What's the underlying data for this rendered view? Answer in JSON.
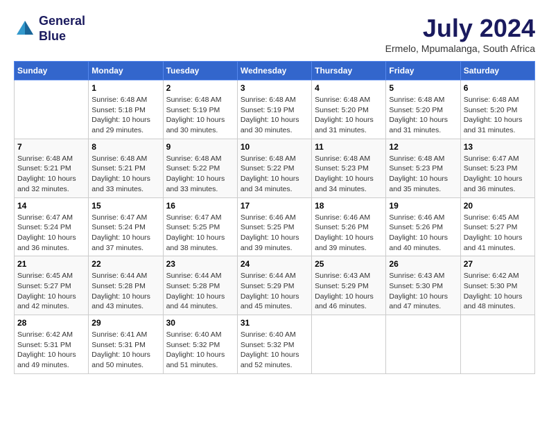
{
  "logo": {
    "line1": "General",
    "line2": "Blue"
  },
  "title": "July 2024",
  "location": "Ermelo, Mpumalanga, South Africa",
  "days_of_week": [
    "Sunday",
    "Monday",
    "Tuesday",
    "Wednesday",
    "Thursday",
    "Friday",
    "Saturday"
  ],
  "weeks": [
    [
      {
        "day": "",
        "sunrise": "",
        "sunset": "",
        "daylight": ""
      },
      {
        "day": "1",
        "sunrise": "Sunrise: 6:48 AM",
        "sunset": "Sunset: 5:18 PM",
        "daylight": "Daylight: 10 hours and 29 minutes."
      },
      {
        "day": "2",
        "sunrise": "Sunrise: 6:48 AM",
        "sunset": "Sunset: 5:19 PM",
        "daylight": "Daylight: 10 hours and 30 minutes."
      },
      {
        "day": "3",
        "sunrise": "Sunrise: 6:48 AM",
        "sunset": "Sunset: 5:19 PM",
        "daylight": "Daylight: 10 hours and 30 minutes."
      },
      {
        "day": "4",
        "sunrise": "Sunrise: 6:48 AM",
        "sunset": "Sunset: 5:20 PM",
        "daylight": "Daylight: 10 hours and 31 minutes."
      },
      {
        "day": "5",
        "sunrise": "Sunrise: 6:48 AM",
        "sunset": "Sunset: 5:20 PM",
        "daylight": "Daylight: 10 hours and 31 minutes."
      },
      {
        "day": "6",
        "sunrise": "Sunrise: 6:48 AM",
        "sunset": "Sunset: 5:20 PM",
        "daylight": "Daylight: 10 hours and 31 minutes."
      }
    ],
    [
      {
        "day": "7",
        "sunrise": "Sunrise: 6:48 AM",
        "sunset": "Sunset: 5:21 PM",
        "daylight": "Daylight: 10 hours and 32 minutes."
      },
      {
        "day": "8",
        "sunrise": "Sunrise: 6:48 AM",
        "sunset": "Sunset: 5:21 PM",
        "daylight": "Daylight: 10 hours and 33 minutes."
      },
      {
        "day": "9",
        "sunrise": "Sunrise: 6:48 AM",
        "sunset": "Sunset: 5:22 PM",
        "daylight": "Daylight: 10 hours and 33 minutes."
      },
      {
        "day": "10",
        "sunrise": "Sunrise: 6:48 AM",
        "sunset": "Sunset: 5:22 PM",
        "daylight": "Daylight: 10 hours and 34 minutes."
      },
      {
        "day": "11",
        "sunrise": "Sunrise: 6:48 AM",
        "sunset": "Sunset: 5:23 PM",
        "daylight": "Daylight: 10 hours and 34 minutes."
      },
      {
        "day": "12",
        "sunrise": "Sunrise: 6:48 AM",
        "sunset": "Sunset: 5:23 PM",
        "daylight": "Daylight: 10 hours and 35 minutes."
      },
      {
        "day": "13",
        "sunrise": "Sunrise: 6:47 AM",
        "sunset": "Sunset: 5:23 PM",
        "daylight": "Daylight: 10 hours and 36 minutes."
      }
    ],
    [
      {
        "day": "14",
        "sunrise": "Sunrise: 6:47 AM",
        "sunset": "Sunset: 5:24 PM",
        "daylight": "Daylight: 10 hours and 36 minutes."
      },
      {
        "day": "15",
        "sunrise": "Sunrise: 6:47 AM",
        "sunset": "Sunset: 5:24 PM",
        "daylight": "Daylight: 10 hours and 37 minutes."
      },
      {
        "day": "16",
        "sunrise": "Sunrise: 6:47 AM",
        "sunset": "Sunset: 5:25 PM",
        "daylight": "Daylight: 10 hours and 38 minutes."
      },
      {
        "day": "17",
        "sunrise": "Sunrise: 6:46 AM",
        "sunset": "Sunset: 5:25 PM",
        "daylight": "Daylight: 10 hours and 39 minutes."
      },
      {
        "day": "18",
        "sunrise": "Sunrise: 6:46 AM",
        "sunset": "Sunset: 5:26 PM",
        "daylight": "Daylight: 10 hours and 39 minutes."
      },
      {
        "day": "19",
        "sunrise": "Sunrise: 6:46 AM",
        "sunset": "Sunset: 5:26 PM",
        "daylight": "Daylight: 10 hours and 40 minutes."
      },
      {
        "day": "20",
        "sunrise": "Sunrise: 6:45 AM",
        "sunset": "Sunset: 5:27 PM",
        "daylight": "Daylight: 10 hours and 41 minutes."
      }
    ],
    [
      {
        "day": "21",
        "sunrise": "Sunrise: 6:45 AM",
        "sunset": "Sunset: 5:27 PM",
        "daylight": "Daylight: 10 hours and 42 minutes."
      },
      {
        "day": "22",
        "sunrise": "Sunrise: 6:44 AM",
        "sunset": "Sunset: 5:28 PM",
        "daylight": "Daylight: 10 hours and 43 minutes."
      },
      {
        "day": "23",
        "sunrise": "Sunrise: 6:44 AM",
        "sunset": "Sunset: 5:28 PM",
        "daylight": "Daylight: 10 hours and 44 minutes."
      },
      {
        "day": "24",
        "sunrise": "Sunrise: 6:44 AM",
        "sunset": "Sunset: 5:29 PM",
        "daylight": "Daylight: 10 hours and 45 minutes."
      },
      {
        "day": "25",
        "sunrise": "Sunrise: 6:43 AM",
        "sunset": "Sunset: 5:29 PM",
        "daylight": "Daylight: 10 hours and 46 minutes."
      },
      {
        "day": "26",
        "sunrise": "Sunrise: 6:43 AM",
        "sunset": "Sunset: 5:30 PM",
        "daylight": "Daylight: 10 hours and 47 minutes."
      },
      {
        "day": "27",
        "sunrise": "Sunrise: 6:42 AM",
        "sunset": "Sunset: 5:30 PM",
        "daylight": "Daylight: 10 hours and 48 minutes."
      }
    ],
    [
      {
        "day": "28",
        "sunrise": "Sunrise: 6:42 AM",
        "sunset": "Sunset: 5:31 PM",
        "daylight": "Daylight: 10 hours and 49 minutes."
      },
      {
        "day": "29",
        "sunrise": "Sunrise: 6:41 AM",
        "sunset": "Sunset: 5:31 PM",
        "daylight": "Daylight: 10 hours and 50 minutes."
      },
      {
        "day": "30",
        "sunrise": "Sunrise: 6:40 AM",
        "sunset": "Sunset: 5:32 PM",
        "daylight": "Daylight: 10 hours and 51 minutes."
      },
      {
        "day": "31",
        "sunrise": "Sunrise: 6:40 AM",
        "sunset": "Sunset: 5:32 PM",
        "daylight": "Daylight: 10 hours and 52 minutes."
      },
      {
        "day": "",
        "sunrise": "",
        "sunset": "",
        "daylight": ""
      },
      {
        "day": "",
        "sunrise": "",
        "sunset": "",
        "daylight": ""
      },
      {
        "day": "",
        "sunrise": "",
        "sunset": "",
        "daylight": ""
      }
    ]
  ]
}
